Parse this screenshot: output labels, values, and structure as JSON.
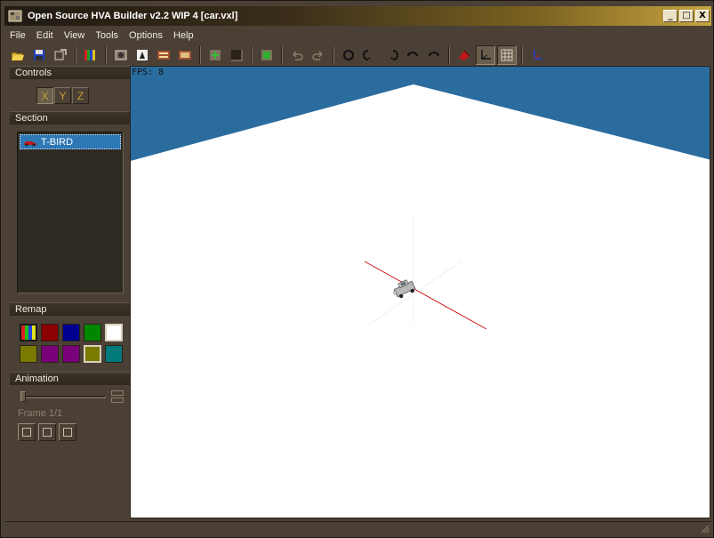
{
  "window": {
    "title": "Open Source HVA Builder v2.2 WIP 4 [car.vxl]",
    "buttons": [
      "_",
      "□",
      "X"
    ]
  },
  "menu": [
    "File",
    "Edit",
    "View",
    "Tools",
    "Options",
    "Help"
  ],
  "toolbar": {
    "icons": [
      "open-icon",
      "save-icon",
      "export-icon",
      "palette-icon",
      "camera-icon",
      "light-icon",
      "hva-icon",
      "hva2-icon",
      "import-icon",
      "brush-icon",
      "new-frame-icon",
      "undo-icon",
      "redo-icon",
      "rotate-icon",
      "rotate-left-icon",
      "rotate-right-icon",
      "turn-left-icon",
      "turn-right-icon",
      "model-icon",
      "axis-icon",
      "grid-icon",
      "pivot-icon"
    ]
  },
  "controls": {
    "header": "Controls",
    "axes": [
      "X",
      "Y",
      "Z"
    ],
    "active_axis": "X"
  },
  "section": {
    "header": "Section",
    "items": [
      "T-BIRD"
    ]
  },
  "remap": {
    "header": "Remap",
    "colors": [
      "#1a1a1a",
      "#8b0000",
      "#000090",
      "#008800",
      "#ffffff",
      "#7a7a00",
      "#7a007a",
      "#7a007a",
      "#7a7a00",
      "#007a7a"
    ],
    "selected_index": 8
  },
  "animation": {
    "header": "Animation",
    "frame_label": "Frame 1/1"
  },
  "viewport": {
    "fps_text": "FPS: 8",
    "sky_color": "#2b6c9f",
    "ground_color": "#ffffff",
    "axis_color": "#d01010"
  }
}
